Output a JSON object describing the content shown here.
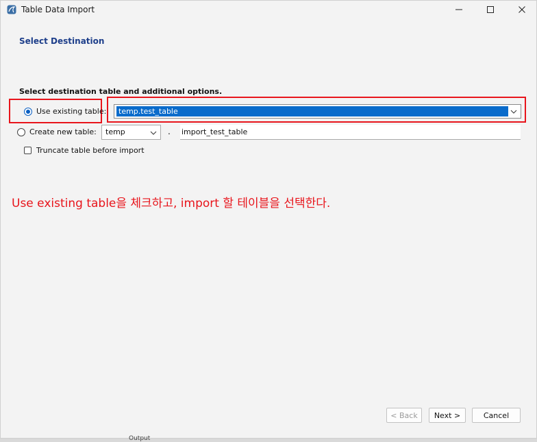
{
  "window": {
    "title": "Table Data Import"
  },
  "page": {
    "section_title": "Select Destination",
    "instruction": "Select destination table and additional options."
  },
  "options": {
    "use_existing_label": "Use existing table:",
    "use_existing_checked": true,
    "existing_table_value": "temp.test_table",
    "create_new_label": "Create new table:",
    "create_new_checked": false,
    "schema_value": "temp",
    "separator": ".",
    "new_table_name": "import_test_table",
    "truncate_label": "Truncate table before import",
    "truncate_checked": false
  },
  "annotation": {
    "text": "Use existing table을 체크하고, import 할 테이블을 선택한다."
  },
  "footer": {
    "back_label": "< Back",
    "next_label": "Next >",
    "cancel_label": "Cancel"
  },
  "background": {
    "peek_text": "Output"
  },
  "colors": {
    "accent": "#0a6bcb",
    "highlight": "#e8141b",
    "section_title": "#1d3e8a"
  }
}
